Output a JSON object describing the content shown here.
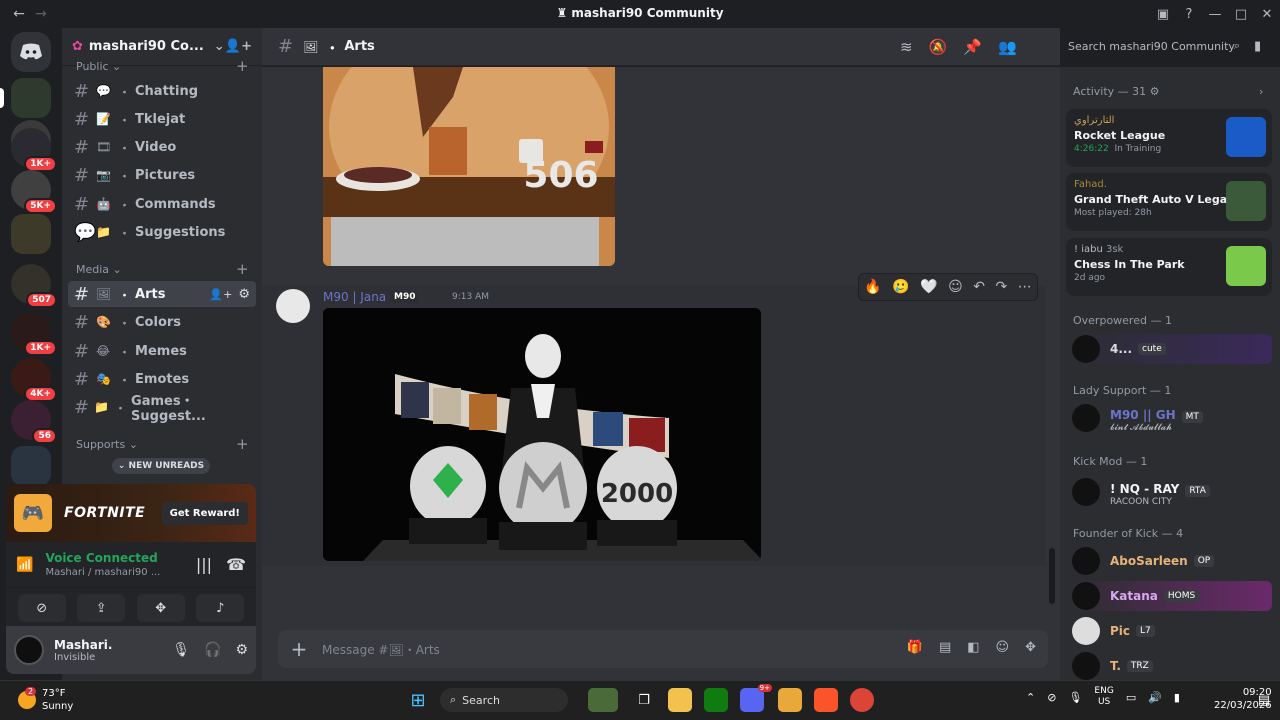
{
  "window": {
    "title": "mashari90 Community"
  },
  "servers": [
    {
      "badge": ""
    },
    {
      "badge": ""
    },
    {
      "badge": "1K+"
    },
    {
      "badge": "5K+"
    },
    {
      "badge": ""
    },
    {
      "badge": "507"
    },
    {
      "badge": "1K+"
    },
    {
      "badge": "4K+"
    },
    {
      "badge": "56"
    },
    {
      "badge": ""
    }
  ],
  "guild": {
    "name": "mashari90 Co..."
  },
  "channels_top": [
    {
      "emoji": "💬",
      "name": "Chatting"
    },
    {
      "emoji": "📝",
      "name": "Tklejat"
    },
    {
      "emoji": "🎞",
      "name": "Video"
    },
    {
      "emoji": "📷",
      "name": "Pictures"
    },
    {
      "emoji": "🤖",
      "name": "Commands"
    },
    {
      "emoji": "📁",
      "name": "Suggestions"
    }
  ],
  "categories": {
    "public": "Public",
    "media": "Media",
    "supports": "Supports"
  },
  "channels_media": [
    {
      "emoji": "🖼",
      "name": "Arts"
    },
    {
      "emoji": "🎨",
      "name": "Colors"
    },
    {
      "emoji": "😂",
      "name": "Memes"
    },
    {
      "emoji": "🎭",
      "name": "Emotes"
    },
    {
      "emoji": "📁",
      "name": "Games・Suggest..."
    }
  ],
  "new_unreads": "NEW UNREADS",
  "promo": {
    "game": "FORTNITE",
    "button": "Get Reward!"
  },
  "voice": {
    "status": "Voice Connected",
    "channel": "Mashari / mashari90 ..."
  },
  "user": {
    "name": "Mashari.",
    "status": "Invisible"
  },
  "channel_header": {
    "name": "Arts"
  },
  "search_placeholder": "Search mashari90 Community",
  "art1_number": "506",
  "message": {
    "author": "M90 | Jana",
    "role": "M90",
    "time": "9:13 AM"
  },
  "art2_number": "2000",
  "composer_placeholder": "Message #🖼・Arts",
  "members": {
    "activity_header": "Activity — 31",
    "activities": [
      {
        "user": "التارتراوي",
        "game": "Rocket League",
        "detail": "4:26:22",
        "detail2": "In Training"
      },
      {
        "user": "Fahad.",
        "game": "Grand Theft Auto V Legacy",
        "detail": "Most played: 28h"
      },
      {
        "user": "! iabu",
        "extra": "3sk",
        "game": "Chess In The Park",
        "detail": "2d ago"
      }
    ],
    "sections": [
      {
        "title": "Overpowered — 1",
        "members": [
          {
            "name": "4...",
            "tag": "cute"
          }
        ]
      },
      {
        "title": "Lady Support — 1",
        "members": [
          {
            "name": "M90 || GH",
            "tag": "MT",
            "sub": "𝓫𝓲𝓷𝓽 𝓐𝓫𝓭𝓾𝓵𝓵𝓪𝓱"
          }
        ]
      },
      {
        "title": "Kick Mod — 1",
        "members": [
          {
            "name": "! NQ - RAY",
            "tag": "RTA",
            "sub": "RACOON CITY"
          }
        ]
      },
      {
        "title": "Founder of Kick — 4",
        "members": [
          {
            "name": "AboSarleen",
            "tag": "OP"
          },
          {
            "name": "Katana",
            "tag": "HOMS"
          },
          {
            "name": "Pic",
            "tag": "L7"
          },
          {
            "name": "T.",
            "tag": "TRZ"
          }
        ]
      }
    ]
  },
  "taskbar": {
    "weather_temp": "73°F",
    "weather_desc": "Sunny",
    "search": "Search",
    "discord_badge": "9+",
    "lang1": "ENG",
    "lang2": "US",
    "time": "09:20",
    "date": "22/03/2026",
    "weather_badge": "2"
  },
  "colors": {
    "accent": "#5865f2",
    "online": "#23a55a",
    "badge": "#f23f43"
  }
}
